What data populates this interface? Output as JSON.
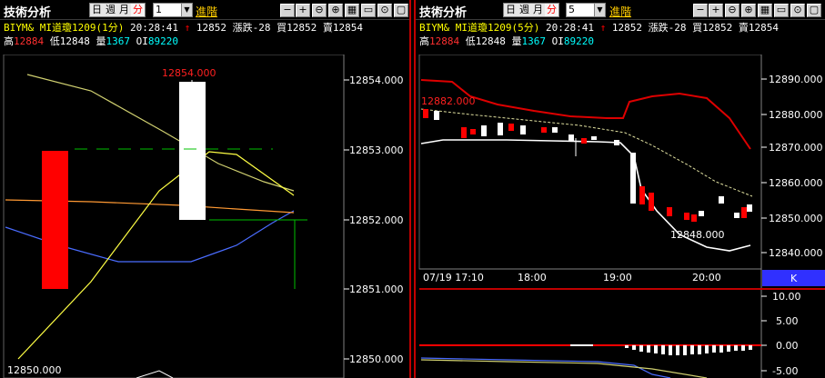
{
  "left": {
    "title": "技術分析",
    "periods": [
      "日",
      "週",
      "月",
      "分"
    ],
    "active_period": "分",
    "interval_value": "1",
    "advanced_label": "進階",
    "symbol": "BIYM& MI道瓊1209(1分)",
    "time": "20:28:41",
    "last": "12852",
    "change": "漲跌-28",
    "bid": "買12852",
    "ask": "賣12854",
    "high_label": "高",
    "high": "12884",
    "low_label": "低",
    "low": "12848",
    "vol_label": "量",
    "volume": "1367",
    "oi_label": "OI",
    "oi": "89220",
    "arrow": "↑",
    "y_ticks": [
      "12854.000",
      "12853.000",
      "12852.000",
      "12851.000",
      "12850.000"
    ],
    "hi_annot": "12854.000",
    "lo_annot": "12850.000"
  },
  "right": {
    "title": "技術分析",
    "periods": [
      "日",
      "週",
      "月",
      "分"
    ],
    "active_period": "分",
    "interval_value": "5",
    "advanced_label": "進階",
    "symbol": "BIYM& MI道瓊1209(5分)",
    "time": "20:28:41",
    "last": "12852",
    "change": "漲跌-28",
    "bid": "買12852",
    "ask": "賣12854",
    "high_label": "高",
    "high": "12884",
    "low_label": "低",
    "low": "12848",
    "vol_label": "量",
    "volume": "1367",
    "oi_label": "OI",
    "oi": "89220",
    "arrow": "↑",
    "y_ticks": [
      "12890.000",
      "12880.000",
      "12870.000",
      "12860.000",
      "12850.000",
      "12840.000"
    ],
    "x_ticks": [
      "07/19 17:10",
      "18:00",
      "19:00",
      "20:00"
    ],
    "k_label": "K",
    "hi_annot": "12882.000",
    "lo_annot": "12848.000",
    "osc_ticks": [
      "10.00",
      "5.00",
      "0.00",
      "-5.00"
    ]
  },
  "toolbar": [
    "−",
    "+",
    "⊖",
    "⊕",
    "▦",
    "▭",
    "⊙",
    "▢"
  ],
  "chart_data": [
    {
      "type": "candlestick",
      "title": "",
      "interval": "1分",
      "ylim": [
        12850,
        12854
      ],
      "candles": [
        {
          "open": 12853,
          "high": 12853,
          "low": 12851,
          "close": 12851,
          "color": "red"
        },
        {
          "open": 12852,
          "high": 12854,
          "low": 12852,
          "close": 12854,
          "color": "white"
        },
        {
          "open": 12852,
          "high": 12852,
          "low": 12851,
          "close": 12852,
          "color": "green"
        }
      ]
    },
    {
      "type": "candlestick",
      "title": "",
      "interval": "5分",
      "ylim": [
        12835,
        12895
      ],
      "x_ticks": [
        "07/19 17:10",
        "18:00",
        "19:00",
        "20:00"
      ],
      "candles_close": [
        12880,
        12878,
        12876,
        12874,
        12873,
        12872,
        12873,
        12874,
        12872,
        12874,
        12873,
        12872,
        12871,
        12872,
        12870,
        12872,
        12871,
        12870,
        12871,
        12870,
        12869,
        12860,
        12853,
        12856,
        12852,
        12850,
        12851,
        12849,
        12850,
        12852,
        12856,
        12852,
        12850,
        12853
      ],
      "upper_band_high": 12889,
      "lower_band_low": 12840
    }
  ]
}
